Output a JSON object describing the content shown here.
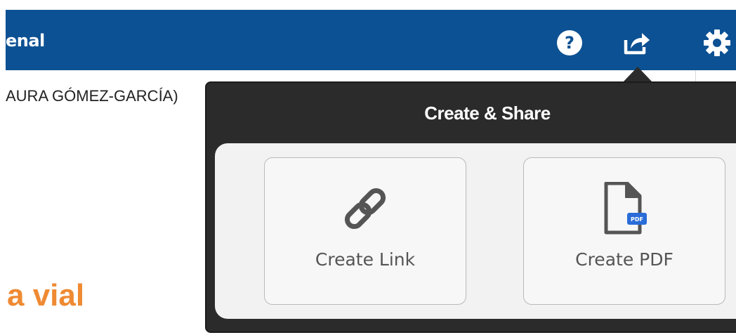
{
  "header": {
    "title": "enal",
    "background_color": "#0c5193",
    "icons": {
      "help": "help-icon",
      "share": "share-icon",
      "settings": "settings-icon"
    }
  },
  "content": {
    "author_line": "AURA GÓMEZ-GARCÍA)",
    "headline": "a vial",
    "headline_color": "#ef8a32"
  },
  "share_popover": {
    "title": "Create & Share",
    "actions": [
      {
        "label": "Create Link",
        "icon": "link-icon"
      },
      {
        "label": "Create PDF",
        "icon": "pdf-file-icon",
        "badge": "PDF"
      }
    ]
  }
}
